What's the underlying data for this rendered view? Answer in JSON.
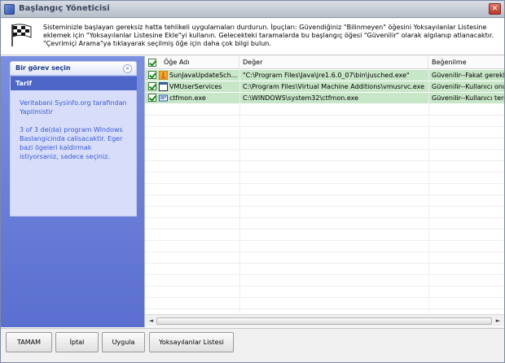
{
  "window": {
    "title": "Başlangıç Yöneticisi",
    "close_glyph": "✕"
  },
  "header": {
    "text": "Sisteminizle başlayan gereksiz hatta tehlikeli uygulamaları durdurun. İpuçları: Güvendiğiniz \"Bilinmeyen\" öğesini Yoksayılanlar Listesine eklemek için \"Yoksayılanlar Listesine Ekle\"yi kullanın. Gelecekteki taramalarda bu başlangıç öğesi \"Güvenilir\" olarak algılanıp atlanacaktır. \"Çevrimiçi Arama\"ya tıklayarak seçilmiş öğe için daha çok bilgi bulun."
  },
  "sidebar": {
    "panel_title": "Bir görev seçin",
    "collapse_glyph": "«",
    "tarif_title": "Tarif",
    "tarif_line1": "Veritabani Sysinfo.org tarafindan Yapilmistir",
    "tarif_line2": "3 of 3 de(da) program Windows Baslangicinda calisacaktir. Eger bazi ögeleri kaldirmak istiyorsaniz, sadece seçiniz."
  },
  "list": {
    "columns": {
      "name": "Öğe Adı",
      "value": "Değer",
      "rating": "Beğenilme"
    },
    "rows": [
      {
        "name": "SunJavaUpdateSch...",
        "value": "\"C:\\Program Files\\Java\\jre1.6.0_07\\bin\\jusched.exe\"",
        "rating": "Güvenilir--Fakat gerekl",
        "icon": "java-icon"
      },
      {
        "name": "VMUserServices",
        "value": "C:\\Program Files\\Virtual Machine Additions\\vmusrvc.exe",
        "rating": "Güvenilir--Kullanıcı onu",
        "icon": "vm-window-icon"
      },
      {
        "name": "ctfmon.exe",
        "value": "C:\\WINDOWS\\system32\\ctfmon.exe",
        "rating": "Güvenilir--Kullanıcı terc",
        "icon": "ctfmon-icon"
      }
    ],
    "scroll_left": "◄",
    "scroll_right": "►"
  },
  "buttons": {
    "ok": "TAMAM",
    "cancel": "İptal",
    "apply": "Uygula",
    "ignore_list": "Yoksayılanlar Listesi"
  },
  "colors": {
    "row_bg": "#c8e6c8",
    "sidebar": "#6a80d8",
    "tarif_text": "#3a5ad8"
  }
}
